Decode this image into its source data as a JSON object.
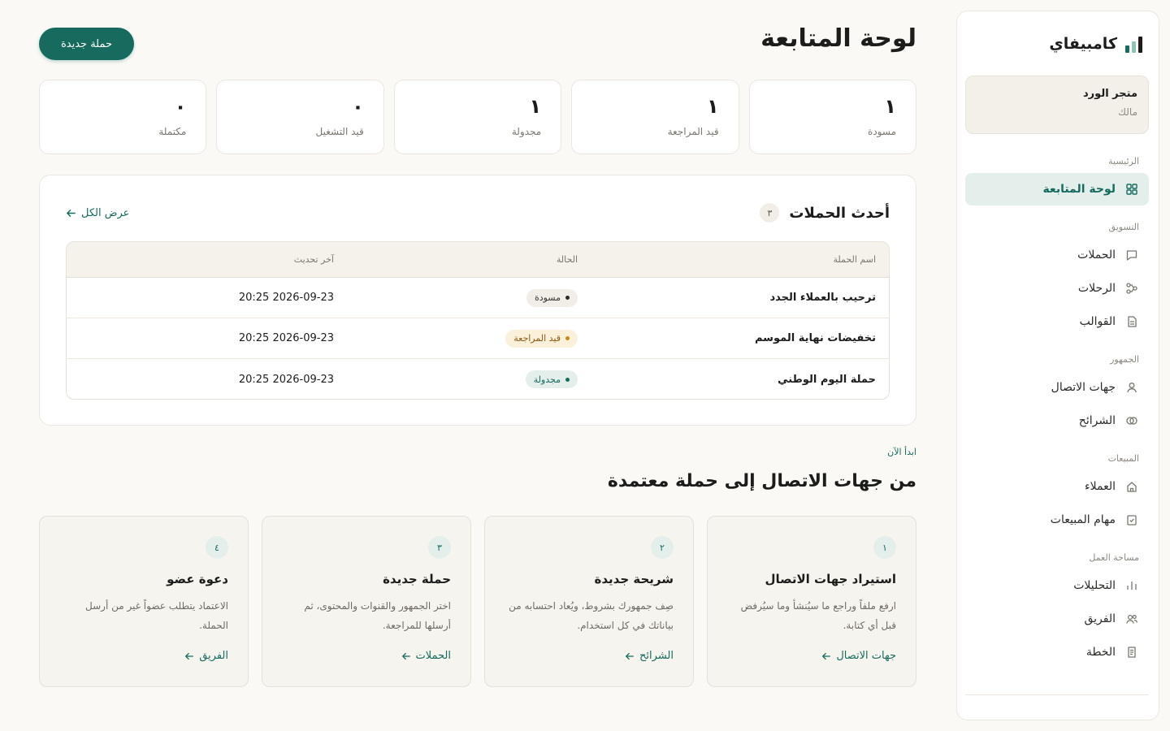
{
  "sidebar": {
    "brand": "كامبيفاي",
    "workspace": {
      "name": "متجر الورد",
      "role": "مالك"
    },
    "sections": {
      "main": "الرئيسية",
      "marketing": "التسويق",
      "audience": "الجمهور",
      "sales": "المبيعات",
      "workspace": "مساحة العمل"
    },
    "items": {
      "dashboard": "لوحة المتابعة",
      "campaigns": "الحملات",
      "journeys": "الرحلات",
      "templates": "القوالب",
      "contacts": "جهات الاتصال",
      "segments": "الشرائح",
      "customers": "العملاء",
      "sales_tasks": "مهام المبيعات",
      "analytics": "التحليلات",
      "team": "الفريق",
      "plan": "الخطة"
    }
  },
  "header": {
    "title": "لوحة المتابعة",
    "new_campaign": "حملة جديدة"
  },
  "stats": [
    {
      "value": "١",
      "label": "مسودة"
    },
    {
      "value": "١",
      "label": "قيد المراجعة"
    },
    {
      "value": "١",
      "label": "مجدولة"
    },
    {
      "value": "٠",
      "label": "قيد التشغيل"
    },
    {
      "value": "٠",
      "label": "مكتملة"
    }
  ],
  "recent": {
    "title": "أحدث الحملات",
    "count": "٣",
    "view_all": "عرض الكل",
    "columns": {
      "name": "اسم الحملة",
      "status": "الحالة",
      "updated": "آخر تحديث"
    },
    "rows": [
      {
        "name": "ترحيب بالعملاء الجدد",
        "status": "مسودة",
        "updated": "2026-09-23 20:25"
      },
      {
        "name": "تخفيضات نهاية الموسم",
        "status": "قيد المراجعة",
        "updated": "2026-09-23 20:25"
      },
      {
        "name": "حملة اليوم الوطني",
        "status": "مجدولة",
        "updated": "2026-09-23 20:25"
      }
    ],
    "status_colors": {
      "draft": {
        "bg": "#f1eee8",
        "fg": "#3a3833",
        "dot": "#2a2a27"
      },
      "review": {
        "bg": "#fbf0d9",
        "fg": "#8a5a12",
        "dot": "#c48a1a"
      },
      "scheduled": {
        "bg": "#e4eeeb",
        "fg": "#166b5e",
        "dot": "#166b5e"
      }
    }
  },
  "getting_started": {
    "label": "ابدأ الآن",
    "title": "من جهات الاتصال إلى حملة معتمدة",
    "steps": [
      {
        "num": "١",
        "title": "استيراد جهات الاتصال",
        "desc": "ارفع ملفاً وراجع ما سيُنشأ وما سيُرفض قبل أي كتابة.",
        "link": "جهات الاتصال"
      },
      {
        "num": "٢",
        "title": "شريحة جديدة",
        "desc": "صِف جمهورك بشروط، ويُعاد احتسابه من بياناتك في كل استخدام.",
        "link": "الشرائح"
      },
      {
        "num": "٣",
        "title": "حملة جديدة",
        "desc": "اختر الجمهور والقنوات والمحتوى، ثم أرسلها للمراجعة.",
        "link": "الحملات"
      },
      {
        "num": "٤",
        "title": "دعوة عضو",
        "desc": "الاعتماد يتطلب عضواً غير من أرسل الحملة.",
        "link": "الفريق"
      }
    ]
  },
  "colors": {
    "accent": "#166b5e",
    "accent_soft": "#e4eeeb",
    "background": "#fbf9f6",
    "logo_bars": [
      "#166b5e",
      "#1c1c1a",
      "#8cc5b8"
    ]
  }
}
